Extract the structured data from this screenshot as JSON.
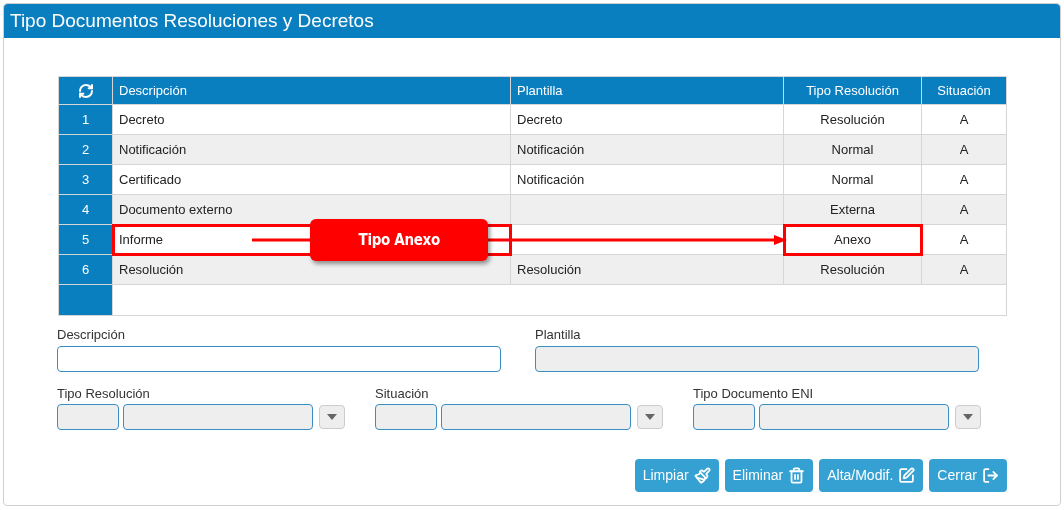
{
  "window": {
    "title": "Tipo Documentos Resoluciones y Decretos"
  },
  "table": {
    "columns": [
      "Descripción",
      "Plantilla",
      "Tipo Resolución",
      "Situación"
    ],
    "rows": [
      {
        "index": "1",
        "descripcion": "Decreto",
        "plantilla": "Decreto",
        "tipo_resolucion": "Resolución",
        "situacion": "A",
        "highlighted": false
      },
      {
        "index": "2",
        "descripcion": "Notificación",
        "plantilla": "Notificación",
        "tipo_resolucion": "Normal",
        "situacion": "A",
        "highlighted": false
      },
      {
        "index": "3",
        "descripcion": "Certificado",
        "plantilla": "Notificación",
        "tipo_resolucion": "Normal",
        "situacion": "A",
        "highlighted": false
      },
      {
        "index": "4",
        "descripcion": "Documento externo",
        "tipo_resolucion": "Externa",
        "situacion": "A",
        "highlighted": false
      },
      {
        "index": "5",
        "descripcion": "Informe",
        "tipo_resolucion": "Anexo",
        "situacion": "A",
        "highlighted": true
      },
      {
        "index": "6",
        "descripcion": "Resolución",
        "plantilla": "Resolución",
        "tipo_resolucion": "Resolución",
        "situacion": "A",
        "highlighted": false
      }
    ]
  },
  "annotation": {
    "label": "Tipo Anexo"
  },
  "form": {
    "descripcion": {
      "label": "Descripción"
    },
    "plantilla": {
      "label": "Plantilla",
      "disabled": true
    },
    "combos": [
      {
        "label": "Tipo Resolución"
      },
      {
        "label": "Situación"
      },
      {
        "label": "Tipo Documento ENI"
      }
    ]
  },
  "buttons": [
    {
      "label": "Limpiar",
      "kind": "clear"
    },
    {
      "label": "Eliminar",
      "kind": "delete"
    },
    {
      "label": "Alta/Modif.",
      "kind": "save"
    },
    {
      "label": "Cerrar",
      "kind": "close"
    }
  ]
}
